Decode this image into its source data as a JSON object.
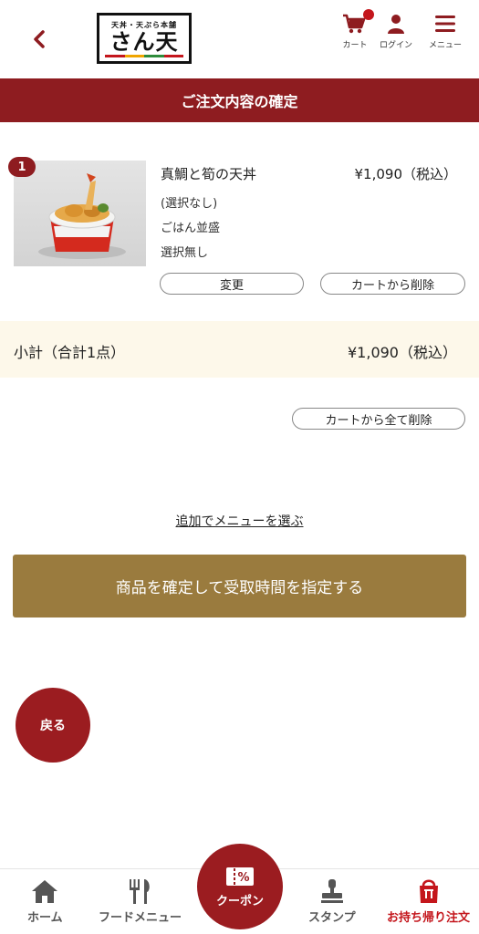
{
  "header": {
    "logo_top": "天丼・天ぷら本舗",
    "logo_main": "さん天",
    "cart_label": "カート",
    "login_label": "ログイン",
    "menu_label": "メニュー"
  },
  "title": "ご注文内容の確定",
  "item": {
    "index": "1",
    "name": "真鯛と筍の天丼",
    "price": "¥1,090（税込）",
    "options": [
      "(選択なし)",
      "ごはん並盛",
      "選択無し"
    ],
    "change_label": "変更",
    "remove_label": "カートから削除"
  },
  "subtotal": {
    "label": "小計（合計1点）",
    "value": "¥1,090（税込）"
  },
  "remove_all_label": "カートから全て削除",
  "add_menu_link": "追加でメニューを選ぶ",
  "confirm_button": "商品を確定して受取時間を指定する",
  "back_button": "戻る",
  "bottom_nav": {
    "home": "ホーム",
    "food_menu": "フードメニュー",
    "coupon": "クーポン",
    "stamp": "スタンプ",
    "takeout": "お持ち帰り注文"
  },
  "colors": {
    "brand_red": "#8e1c20",
    "gold": "#9a7b3e",
    "subtotal_bg": "#fdf8ea"
  }
}
